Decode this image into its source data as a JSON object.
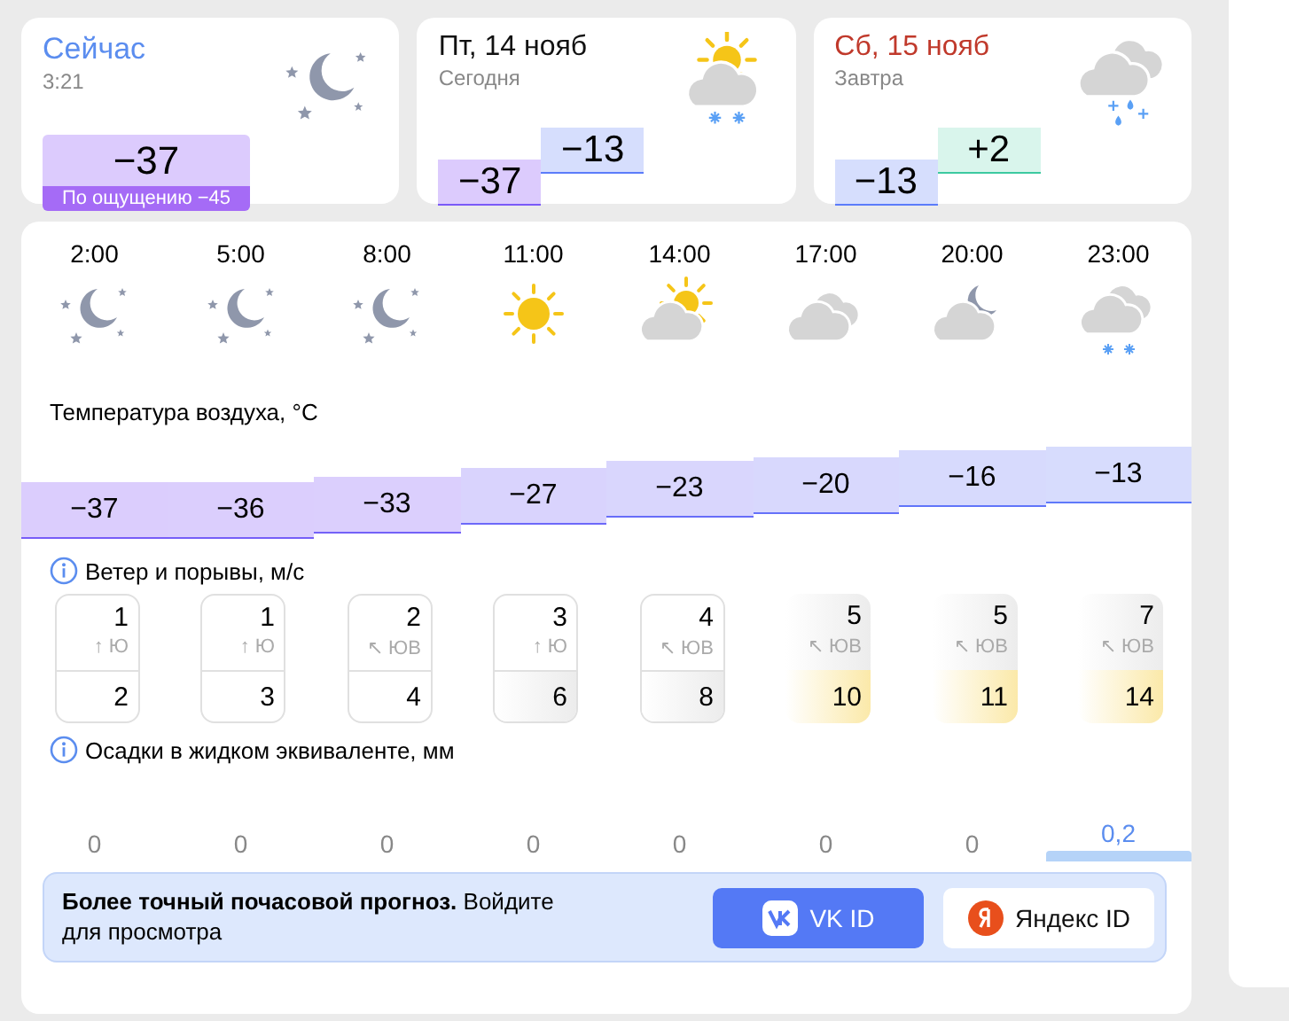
{
  "now": {
    "title": "Сейчас",
    "time": "3:21",
    "kind": "night-clear",
    "temp": "−37",
    "feels": "По ощущению −45"
  },
  "days": [
    {
      "title": "Пт, 14 нояб",
      "weekend": false,
      "subtitle": "Сегодня",
      "kind": "sun-cloud-snow",
      "min": {
        "value": "−37",
        "kind": "frost"
      },
      "max": {
        "value": "−13",
        "kind": "cold"
      }
    },
    {
      "title": "Сб, 15 нояб",
      "weekend": true,
      "subtitle": "Завтра",
      "kind": "cloud-sleet",
      "min": {
        "value": "−13",
        "kind": "cold"
      },
      "max": {
        "value": "+2",
        "kind": "mild"
      }
    }
  ],
  "hours": [
    {
      "time": "2:00",
      "kind": "night-clear",
      "temp": "−37"
    },
    {
      "time": "5:00",
      "kind": "night-clear",
      "temp": "−36"
    },
    {
      "time": "8:00",
      "kind": "night-clear",
      "temp": "−33"
    },
    {
      "time": "11:00",
      "kind": "sunny",
      "temp": "−27"
    },
    {
      "time": "14:00",
      "kind": "sun-cloud",
      "temp": "−23"
    },
    {
      "time": "17:00",
      "kind": "cloudy",
      "temp": "−20"
    },
    {
      "time": "20:00",
      "kind": "moon-cloud",
      "temp": "−16"
    },
    {
      "time": "23:00",
      "kind": "cloud-snow",
      "temp": "−13"
    }
  ],
  "temp_label": "Температура воздуха, °C",
  "wind_label": "Ветер и порывы, м/с",
  "wind": [
    {
      "speed": "1",
      "arrow": "↑",
      "direction": "Ю",
      "gust": "2",
      "kind": "light"
    },
    {
      "speed": "1",
      "arrow": "↑",
      "direction": "Ю",
      "gust": "3",
      "kind": "light"
    },
    {
      "speed": "2",
      "arrow": "↖",
      "direction": "ЮВ",
      "gust": "4",
      "kind": "light"
    },
    {
      "speed": "3",
      "arrow": "↑",
      "direction": "Ю",
      "gust": "6",
      "kind": "moderate"
    },
    {
      "speed": "4",
      "arrow": "↖",
      "direction": "ЮВ",
      "gust": "8",
      "kind": "moderate"
    },
    {
      "speed": "5",
      "arrow": "↖",
      "direction": "ЮВ",
      "gust": "10",
      "kind": "strong"
    },
    {
      "speed": "5",
      "arrow": "↖",
      "direction": "ЮВ",
      "gust": "11",
      "kind": "strong"
    },
    {
      "speed": "7",
      "arrow": "↖",
      "direction": "ЮВ",
      "gust": "14",
      "kind": "strong"
    }
  ],
  "precip_label": "Осадки в жидком эквиваленте, мм",
  "precip": [
    {
      "value": "0",
      "kind": "dry"
    },
    {
      "value": "0",
      "kind": "dry"
    },
    {
      "value": "0",
      "kind": "dry"
    },
    {
      "value": "0",
      "kind": "dry"
    },
    {
      "value": "0",
      "kind": "dry"
    },
    {
      "value": "0",
      "kind": "dry"
    },
    {
      "value": "0",
      "kind": "dry"
    },
    {
      "value": "0,2",
      "kind": "wet"
    }
  ],
  "banner": {
    "text": "**Более точный почасовой прогноз.** Войдите для просмотра",
    "buttons": [
      {
        "label": "VK ID",
        "kind": "vk"
      },
      {
        "label": "Яндекс ID",
        "kind": "yandex"
      }
    ]
  }
}
